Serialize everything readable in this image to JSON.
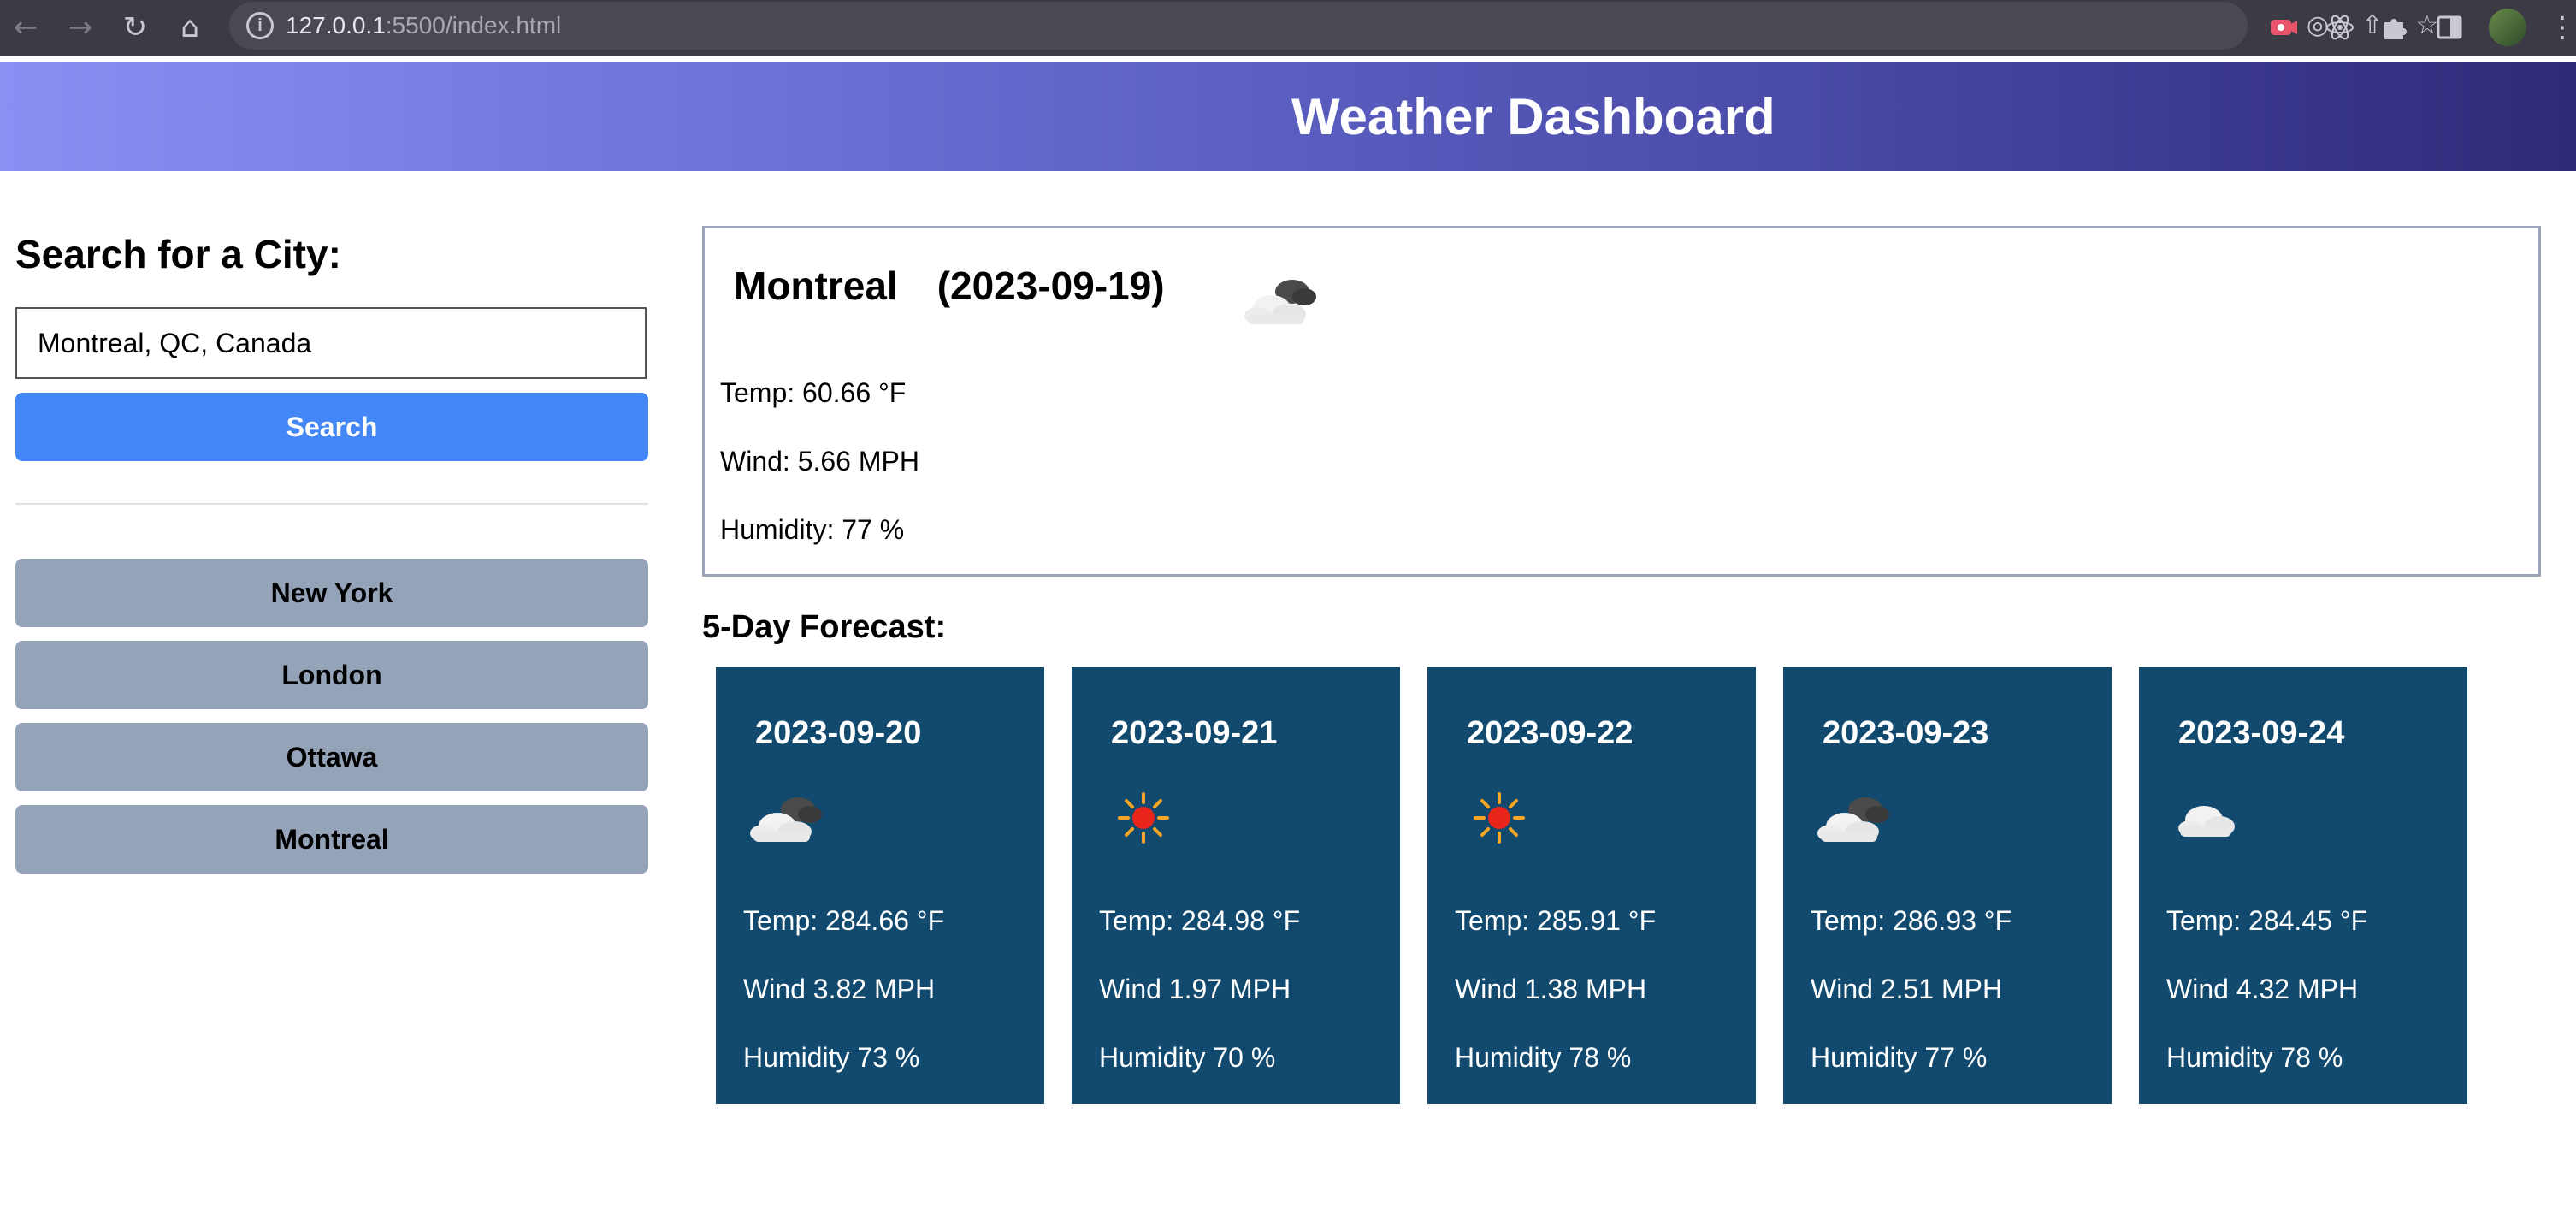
{
  "browser": {
    "url_host": "127.0.0.1",
    "url_path": ":5500/index.html"
  },
  "header": {
    "title": "Weather Dashboard"
  },
  "sidebar": {
    "title": "Search for a City:",
    "search_value": "Montreal, QC, Canada",
    "search_button": "Search",
    "history": [
      "New York",
      "London",
      "Ottawa",
      "Montreal"
    ]
  },
  "current": {
    "city": "Montreal",
    "date": "(2023-09-19)",
    "icon": "cloud-sun-icon",
    "temp": "Temp: 60.66 °F",
    "wind": "Wind: 5.66 MPH",
    "humidity": "Humidity: 77 %"
  },
  "forecast": {
    "title": "5-Day Forecast:",
    "days": [
      {
        "date": "2023-09-20",
        "icon": "cloud-sun-icon",
        "temp": "Temp: 284.66 °F",
        "wind": "Wind 3.82 MPH",
        "humidity": "Humidity 73 %"
      },
      {
        "date": "2023-09-21",
        "icon": "sun-icon",
        "temp": "Temp: 284.98 °F",
        "wind": "Wind 1.97 MPH",
        "humidity": "Humidity 70 %"
      },
      {
        "date": "2023-09-22",
        "icon": "sun-icon",
        "temp": "Temp: 285.91 °F",
        "wind": "Wind 1.38 MPH",
        "humidity": "Humidity 78 %"
      },
      {
        "date": "2023-09-23",
        "icon": "cloud-sun-icon",
        "temp": "Temp: 286.93 °F",
        "wind": "Wind 2.51 MPH",
        "humidity": "Humidity 77 %"
      },
      {
        "date": "2023-09-24",
        "icon": "cloud-icon",
        "temp": "Temp: 284.45 °F",
        "wind": "Wind 4.32 MPH",
        "humidity": "Humidity 78 %"
      }
    ]
  },
  "colors": {
    "header_start": "#8a8ff2",
    "header_end": "#2e2a78",
    "search_button": "#4287f5",
    "history_button": "#95a3b8",
    "forecast_card": "#114a6e"
  }
}
